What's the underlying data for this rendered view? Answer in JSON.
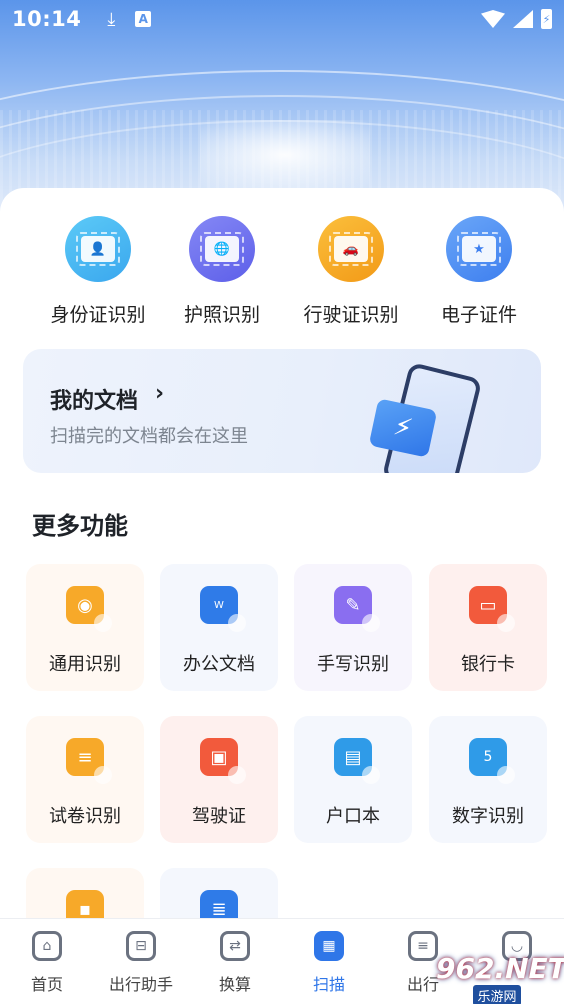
{
  "status_bar": {
    "time": "10:14",
    "download_icon": "download-icon",
    "a_badge": "A",
    "battery_symbol": "⚡"
  },
  "quick_actions": [
    {
      "label": "身份证识别",
      "icon": "id-card-icon",
      "color": "#3fb3f0"
    },
    {
      "label": "护照识别",
      "icon": "passport-icon",
      "color": "#6b6ef0"
    },
    {
      "label": "行驶证识别",
      "icon": "car-license-icon",
      "color": "#f5a623"
    },
    {
      "label": "电子证件",
      "icon": "electronic-id-icon",
      "color": "#4a8ef5"
    }
  ],
  "my_docs": {
    "title": "我的文档",
    "chevron": "›",
    "subtitle": "扫描完的文档都会在这里"
  },
  "more": {
    "title": "更多功能",
    "items": [
      {
        "label": "通用识别",
        "icon": "camera-icon",
        "color": "#f7a929",
        "bg": "#fff8f2"
      },
      {
        "label": "办公文档",
        "icon": "word-doc-icon",
        "color": "#2f7be8",
        "bg": "#f4f7fd"
      },
      {
        "label": "手写识别",
        "icon": "pen-icon",
        "color": "#8a6ef0",
        "bg": "#f7f5fd"
      },
      {
        "label": "银行卡",
        "icon": "bank-card-icon",
        "color": "#f25a3c",
        "bg": "#fef0ee"
      },
      {
        "label": "试卷识别",
        "icon": "exam-paper-icon",
        "color": "#f7a929",
        "bg": "#fff8f2"
      },
      {
        "label": "驾驶证",
        "icon": "driver-license-icon",
        "color": "#f25a3c",
        "bg": "#fef0ee"
      },
      {
        "label": "户口本",
        "icon": "household-book-icon",
        "color": "#2f9be8",
        "bg": "#f4f7fd"
      },
      {
        "label": "数字识别",
        "icon": "number-icon",
        "color": "#2f9be8",
        "bg": "#f4f7fd"
      },
      {
        "label": "",
        "icon": "id-badge-icon",
        "color": "#f7a929",
        "bg": "#fff8f2"
      },
      {
        "label": "",
        "icon": "document-icon",
        "color": "#2f7be8",
        "bg": "#f4f7fd"
      }
    ]
  },
  "nav": {
    "items": [
      {
        "label": "首页",
        "icon": "home-icon"
      },
      {
        "label": "出行助手",
        "icon": "luggage-icon"
      },
      {
        "label": "换算",
        "icon": "convert-icon"
      },
      {
        "label": "扫描",
        "icon": "scan-icon",
        "active": true
      },
      {
        "label": "出行",
        "icon": "clipboard-icon"
      },
      {
        "label": "",
        "icon": "profile-icon"
      }
    ],
    "active_color": "#2f76e8"
  },
  "watermark": {
    "brand": "962.NET",
    "sub": "乐游网"
  }
}
